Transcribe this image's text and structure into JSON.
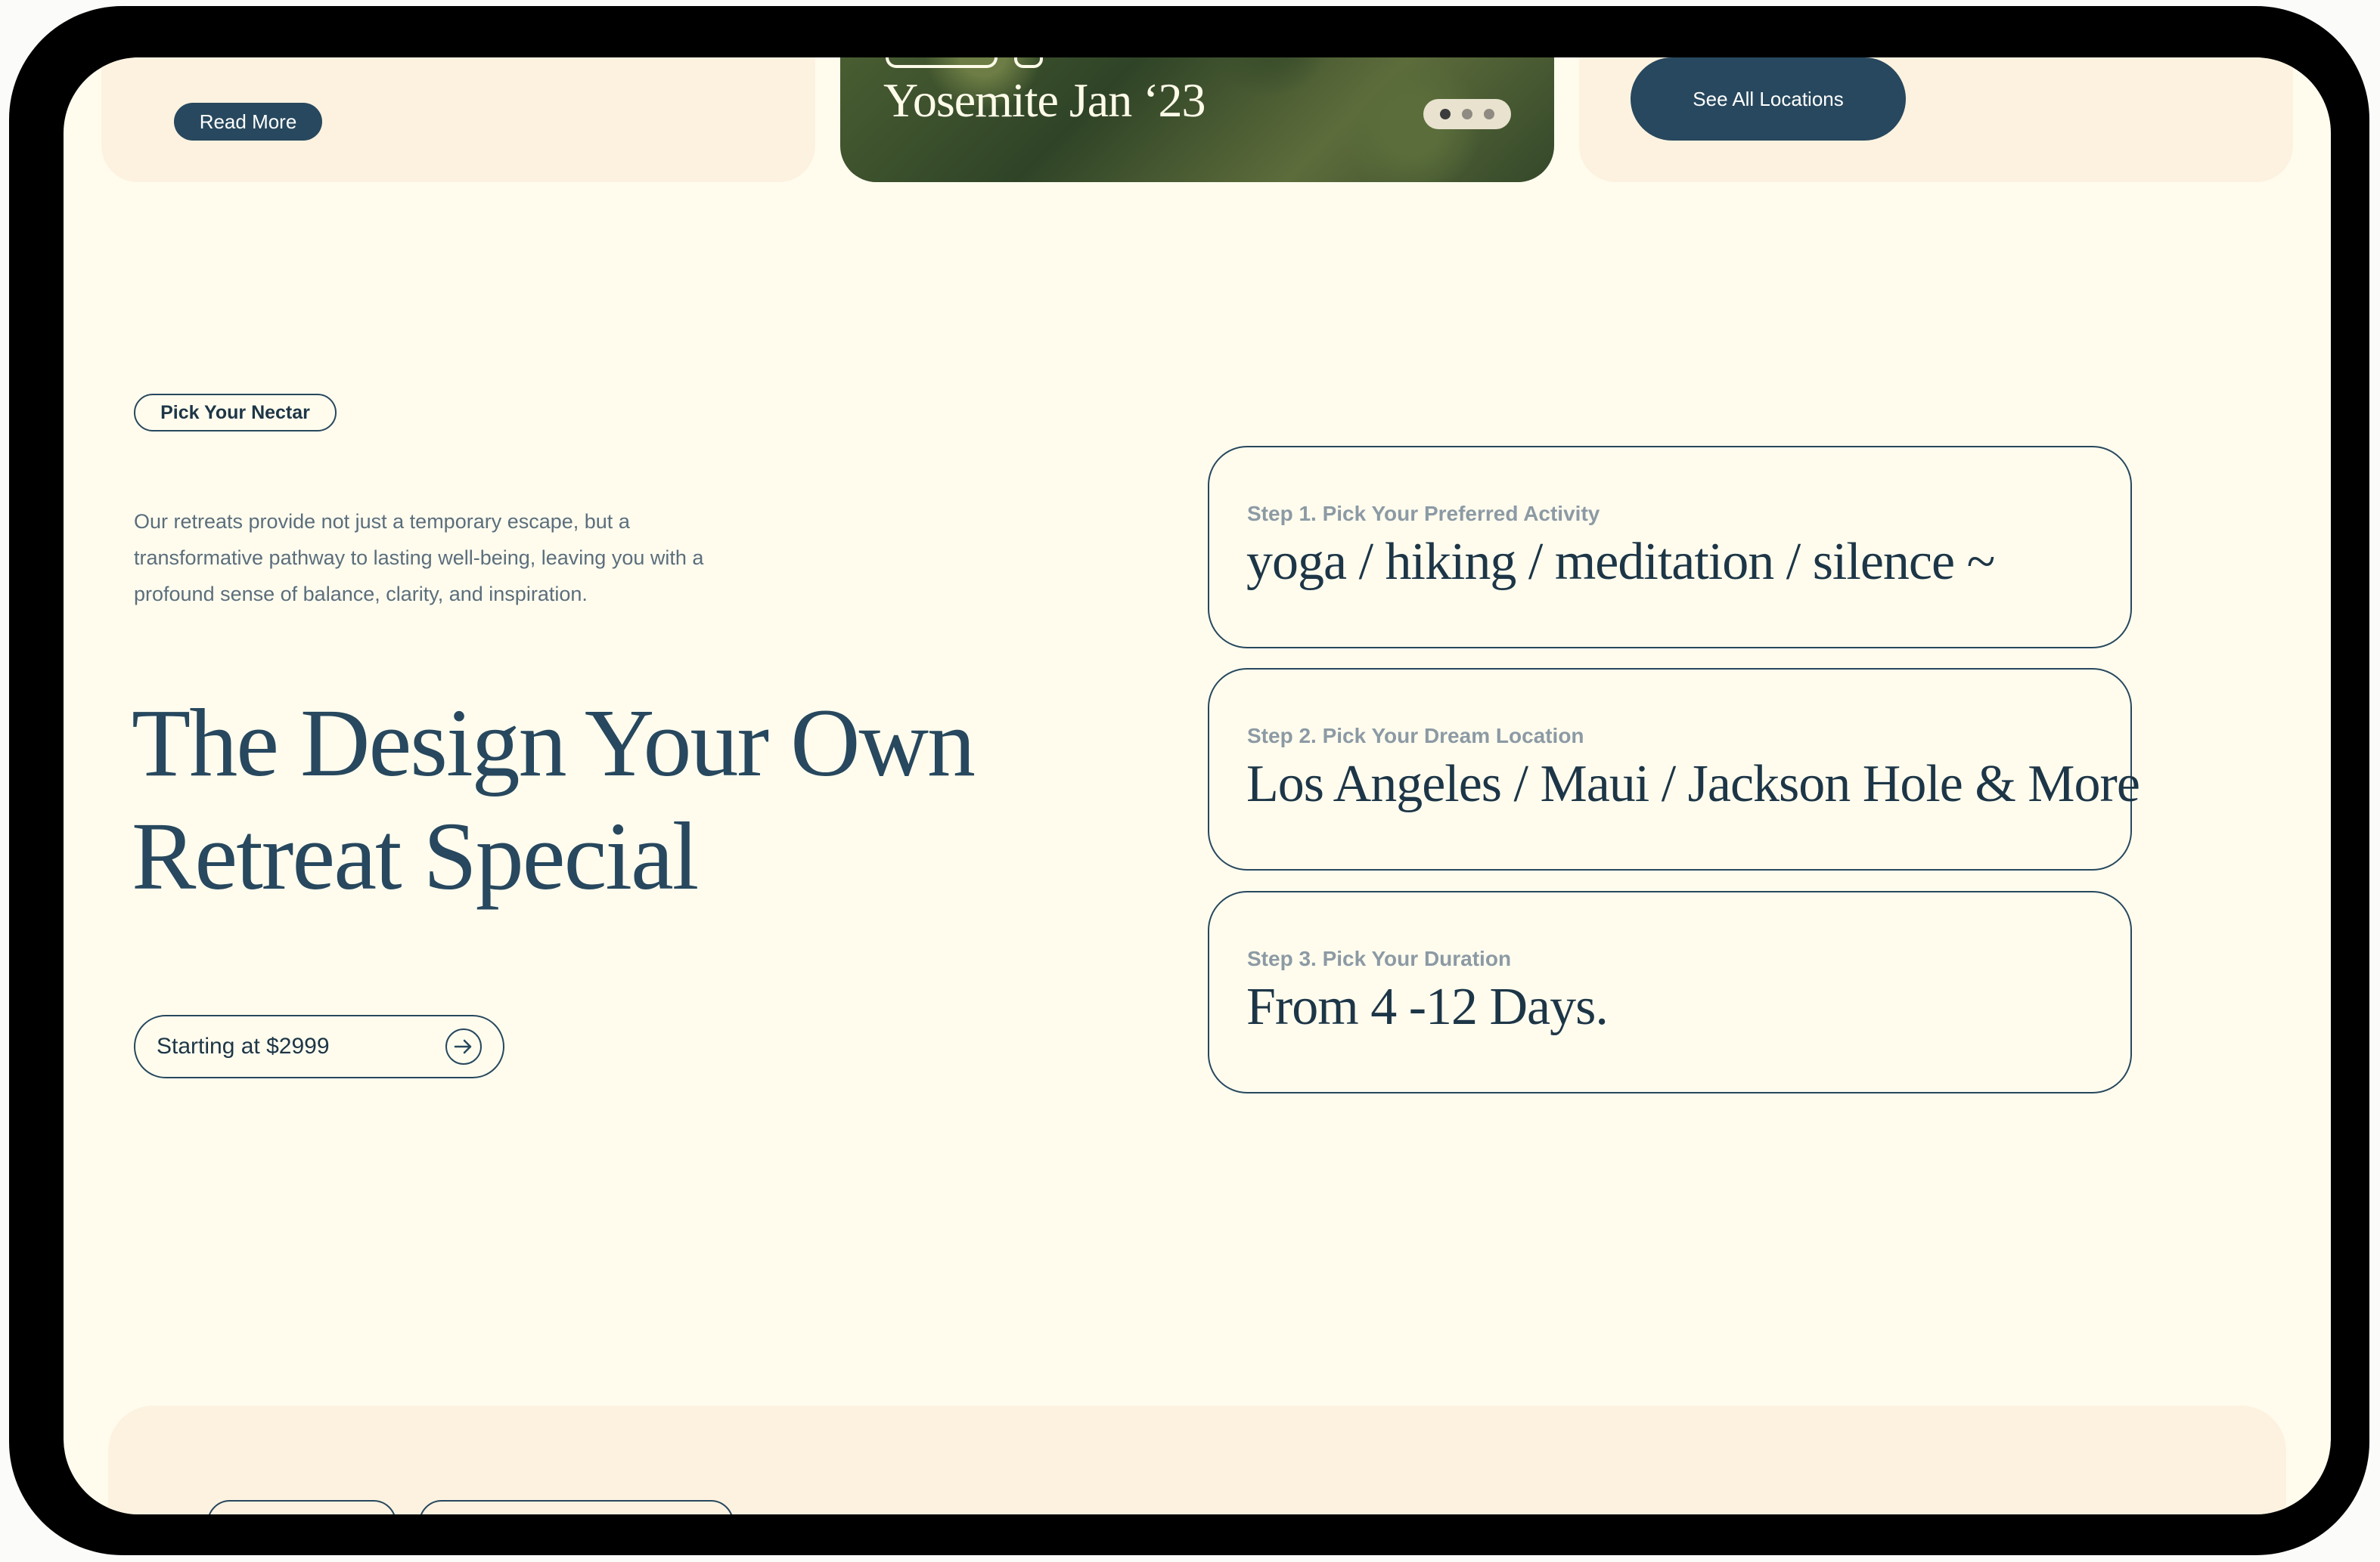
{
  "top_cards": {
    "read_more_label": "Read More",
    "photo_title": "Yosemite Jan ‘23",
    "see_all_label": "See All Locations",
    "carousel": {
      "count": 3,
      "active": 1
    }
  },
  "intro": {
    "badge": "Pick Your Nectar",
    "description": "Our retreats provide not just a temporary escape, but a transformative pathway to lasting well-being, leaving you with a profound sense of balance, clarity, and inspiration.",
    "headline_line1": "The Design Your Own",
    "headline_line2": "Retreat Special",
    "price_label": "Starting at $2999"
  },
  "steps": [
    {
      "label": "Step 1.  Pick Your Preferred Activity",
      "value": "yoga  / hiking  / meditation / silence ~"
    },
    {
      "label": "Step 2.  Pick Your Dream Location",
      "value": "Los Angeles / Maui / Jackson Hole & More"
    },
    {
      "label": "Step 3.  Pick Your Duration",
      "value": "From 4 -12 Days."
    }
  ],
  "colors": {
    "background": "#fffcee",
    "card": "#fdf2e0",
    "primary": "#27485e",
    "muted_text": "#8c9aa4"
  }
}
